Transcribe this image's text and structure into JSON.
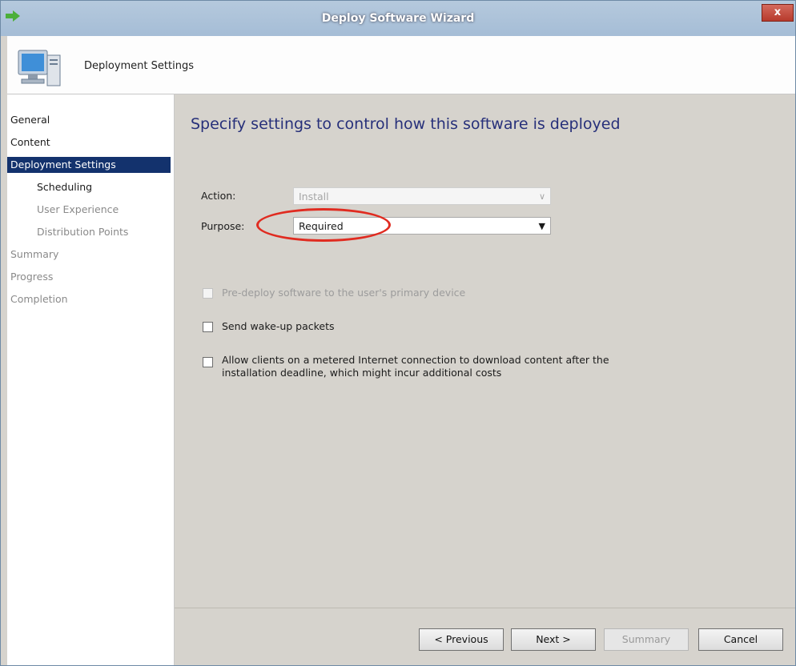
{
  "window": {
    "title": "Deploy Software Wizard",
    "close_label": "x"
  },
  "header": {
    "title": "Deployment Settings",
    "icon": "computer-icon"
  },
  "nav": {
    "items": [
      {
        "label": "General"
      },
      {
        "label": "Content"
      },
      {
        "label": "Deployment Settings"
      },
      {
        "label": "Scheduling"
      },
      {
        "label": "User Experience"
      },
      {
        "label": "Distribution Points"
      },
      {
        "label": "Summary"
      },
      {
        "label": "Progress"
      },
      {
        "label": "Completion"
      }
    ]
  },
  "content": {
    "heading": "Specify settings to control how this software is deployed",
    "action_label": "Action:",
    "action_value": "Install",
    "purpose_label": "Purpose:",
    "purpose_value": "Required",
    "checkboxes": [
      {
        "label": "Pre-deploy software to the user's primary device",
        "checked": false,
        "enabled": false
      },
      {
        "label": "Send wake-up packets",
        "checked": false,
        "enabled": true
      },
      {
        "label_line1": "Allow clients on a metered Internet connection to download content after the",
        "label_line2": "installation deadline, which might incur additional costs",
        "checked": false,
        "enabled": true
      }
    ]
  },
  "footer": {
    "previous_label": "< Previous",
    "next_label": "Next >",
    "summary_label": "Summary",
    "cancel_label": "Cancel"
  },
  "colors": {
    "nav_active": "#13326d",
    "heading": "#27307a",
    "highlight": "#e02b20"
  }
}
